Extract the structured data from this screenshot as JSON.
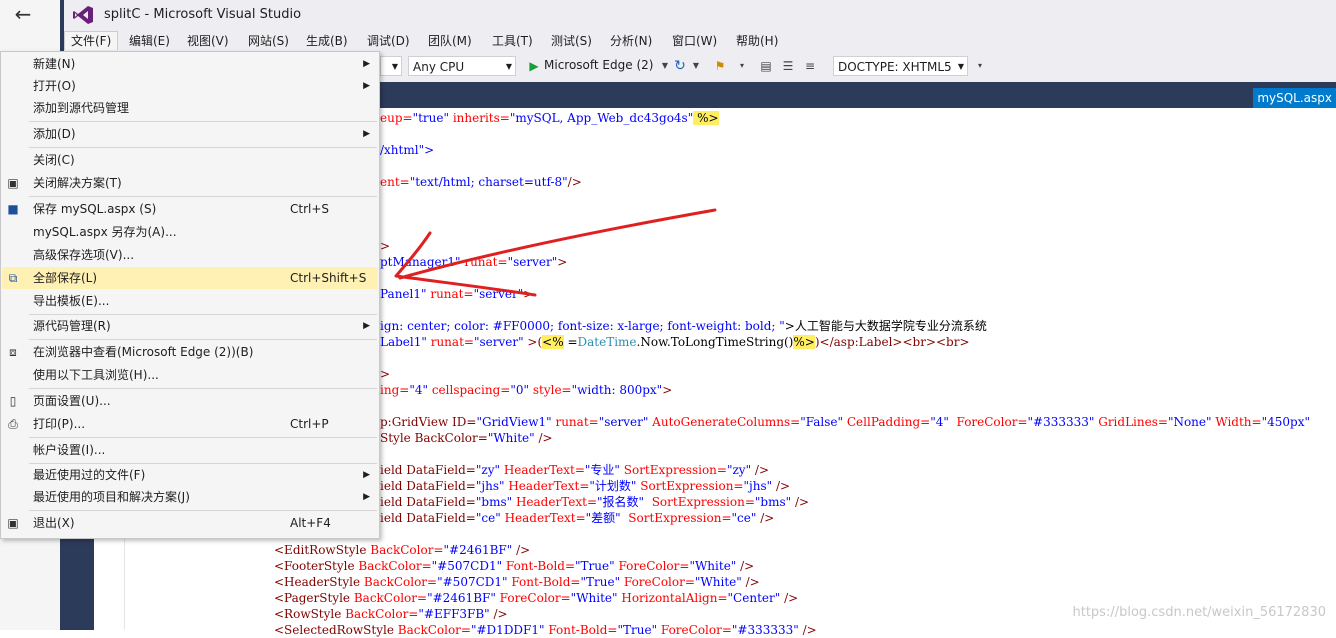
{
  "window": {
    "title": "splitC - Microsoft Visual Studio",
    "back_glyph": "←"
  },
  "menubar": [
    "文件(F)",
    "编辑(E)",
    "视图(V)",
    "网站(S)",
    "生成(B)",
    "调试(D)",
    "团队(M)",
    "工具(T)",
    "测试(S)",
    "分析(N)",
    "窗口(W)",
    "帮助(H)"
  ],
  "toolbar": {
    "platform": "Any CPU",
    "browser": "Microsoft Edge (2)",
    "doctype": "DOCTYPE: XHTML5"
  },
  "doc_tab": "mySQL.aspx",
  "file_menu": [
    {
      "label": "新建(N)",
      "shortcut": "",
      "submenu": true
    },
    {
      "label": "打开(O)",
      "shortcut": "",
      "submenu": true
    },
    {
      "label": "添加到源代码管理",
      "shortcut": "",
      "submenu": false
    },
    {
      "label": "添加(D)",
      "shortcut": "",
      "submenu": true
    },
    {
      "label": "关闭(C)",
      "shortcut": "",
      "submenu": false
    },
    {
      "label": "关闭解决方案(T)",
      "shortcut": "",
      "submenu": false
    },
    {
      "label": "保存 mySQL.aspx (S)",
      "shortcut": "Ctrl+S",
      "submenu": false
    },
    {
      "label": "mySQL.aspx 另存为(A)...",
      "shortcut": "",
      "submenu": false
    },
    {
      "label": "高级保存选项(V)...",
      "shortcut": "",
      "submenu": false
    },
    {
      "label": "全部保存(L)",
      "shortcut": "Ctrl+Shift+S",
      "submenu": false
    },
    {
      "label": "导出模板(E)...",
      "shortcut": "",
      "submenu": false
    },
    {
      "label": "源代码管理(R)",
      "shortcut": "",
      "submenu": true
    },
    {
      "label": "在浏览器中查看(Microsoft Edge (2))(B)",
      "shortcut": "",
      "submenu": false
    },
    {
      "label": "使用以下工具浏览(H)...",
      "shortcut": "",
      "submenu": false
    },
    {
      "label": "页面设置(U)...",
      "shortcut": "",
      "submenu": false
    },
    {
      "label": "打印(P)...",
      "shortcut": "Ctrl+P",
      "submenu": false
    },
    {
      "label": "帐户设置(I)...",
      "shortcut": "",
      "submenu": false
    },
    {
      "label": "最近使用过的文件(F)",
      "shortcut": "",
      "submenu": true
    },
    {
      "label": "最近使用的项目和解决方案(J)",
      "shortcut": "",
      "submenu": true
    },
    {
      "label": "退出(X)",
      "shortcut": "Alt+F4",
      "submenu": false
    }
  ],
  "code": {
    "l1": [
      "eup=",
      "\"true\"",
      " inherits=",
      "\"mySQL, App_Web_dc43go4s\"",
      " %>"
    ],
    "l2": "/xhtml\">",
    "l3": [
      "ent=",
      "\"text/html; charset=utf-8\"",
      "/>"
    ],
    "l4": ">",
    "l5": [
      "ptManager1\"",
      " runat=",
      "\"server\"",
      ">"
    ],
    "l6": [
      "Panel1\"",
      " runat=",
      "\"server\"",
      ">"
    ],
    "l7": [
      "ign: center; color: #FF0000; font-size: x-large; font-weight: bold; \"",
      ">人工智能与大数据学院专业分流系统"
    ],
    "l8": [
      "Label1\"",
      " runat=",
      "\"server\"",
      " >(",
      "<%",
      " =",
      "DateTime",
      ".Now.ToLongTimeString()",
      "%>",
      ")",
      "</asp:Label><br><br>"
    ],
    "l9": ">",
    "l10": [
      "ing=",
      "\"4\"",
      " cellspacing=",
      "\"0\"",
      " style=",
      "\"width: 800px\"",
      ">"
    ],
    "l11": [
      "p:GridView ID=",
      "\"GridView1\"",
      " runat=",
      "\"server\"",
      " AutoGenerateColumns=",
      "\"False\"",
      " CellPadding=",
      "\"4\"",
      "  ForeColor=",
      "\"#333333\"",
      " GridLines=",
      "\"None\"",
      " Width=",
      "\"450px\""
    ],
    "l12": [
      "Style BackColor=",
      "\"White\"",
      " />"
    ],
    "l13": [
      "ield DataField=",
      "\"zy\"",
      " HeaderText=",
      "\"专业\"",
      " SortExpression=",
      "\"zy\"",
      " />"
    ],
    "l14": [
      "ield DataField=",
      "\"jhs\"",
      " HeaderText=",
      "\"计划数\"",
      " SortExpression=",
      "\"jhs\"",
      " />"
    ],
    "l15": [
      "ield DataField=",
      "\"bms\"",
      " HeaderText=",
      "\"报名数\"",
      "  SortExpression=",
      "\"bms\"",
      " />"
    ],
    "l16": [
      "ield DataField=",
      "\"ce\"",
      " HeaderText=",
      "\"差额\"",
      "  SortExpression=",
      "\"ce\"",
      " />"
    ],
    "l17": [
      "<EditRowStyle",
      " BackColor=",
      "\"#2461BF\"",
      " />"
    ],
    "l18": [
      "<FooterStyle",
      " BackColor=",
      "\"#507CD1\"",
      " Font-Bold=",
      "\"True\"",
      " ForeColor=",
      "\"White\"",
      " />"
    ],
    "l19": [
      "<HeaderStyle",
      " BackColor=",
      "\"#507CD1\"",
      " Font-Bold=",
      "\"True\"",
      " ForeColor=",
      "\"White\"",
      " />"
    ],
    "l20": [
      "<PagerStyle",
      " BackColor=",
      "\"#2461BF\"",
      " ForeColor=",
      "\"White\"",
      " HorizontalAlign=",
      "\"Center\"",
      " />"
    ],
    "l21": [
      "<RowStyle",
      " BackColor=",
      "\"#EFF3FB\"",
      " />"
    ],
    "l22": [
      "<SelectedRowStyle",
      " BackColor=",
      "\"#D1DDF1\"",
      " Font-Bold=",
      "\"True\"",
      " ForeColor=",
      "\"#333333\"",
      " />"
    ]
  },
  "watermark": "https://blog.csdn.net/weixin_56172830",
  "annotation_color": "#e02020"
}
